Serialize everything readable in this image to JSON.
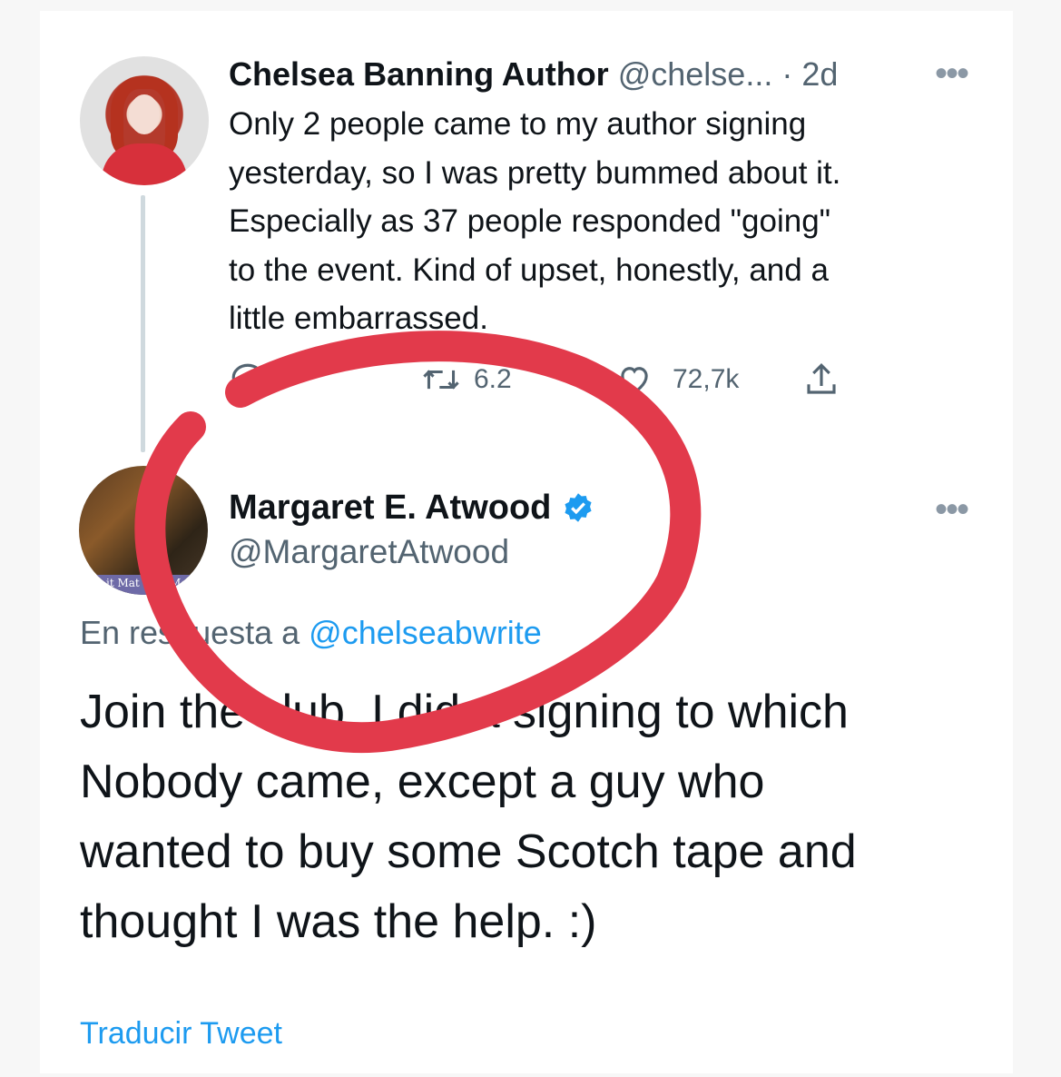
{
  "tweet1": {
    "author_name": "Chelsea Banning Author",
    "handle": "@chelse...",
    "separator": " · ",
    "time": "2d",
    "text_lines": [
      "Only 2 people came to my author signing",
      "yesterday, so I was pretty bummed about it.",
      "Especially as 37 people responded \"going\"",
      "to the event. Kind of upset, honestly, and a",
      "little embarrassed."
    ],
    "actions": {
      "reply_count": "",
      "retweet_count": "6.2",
      "like_count": "72,7k"
    },
    "more_icon": "more-horizontal-icon"
  },
  "tweet2": {
    "author_name": "Margaret E. Atwood",
    "verified_icon": "verified-badge-icon",
    "handle": "@MargaretAtwood",
    "reply_prefix": "En respuesta a ",
    "reply_target": "@chelseabwrite",
    "text_lines": [
      "Join the club. I did a signing to which",
      "Nobody came, except a guy who",
      "wanted to buy some Scotch tape and",
      "thought I was the help. :)"
    ],
    "translate_label": "Traducir Tweet",
    "avatar_caption_left": "it Mat",
    "avatar_caption_right": "Me."
  },
  "colors": {
    "link": "#1d9bf0",
    "secondary_text": "#536471",
    "primary_text": "#0f1419",
    "annotation_circle": "#e23a4b"
  }
}
